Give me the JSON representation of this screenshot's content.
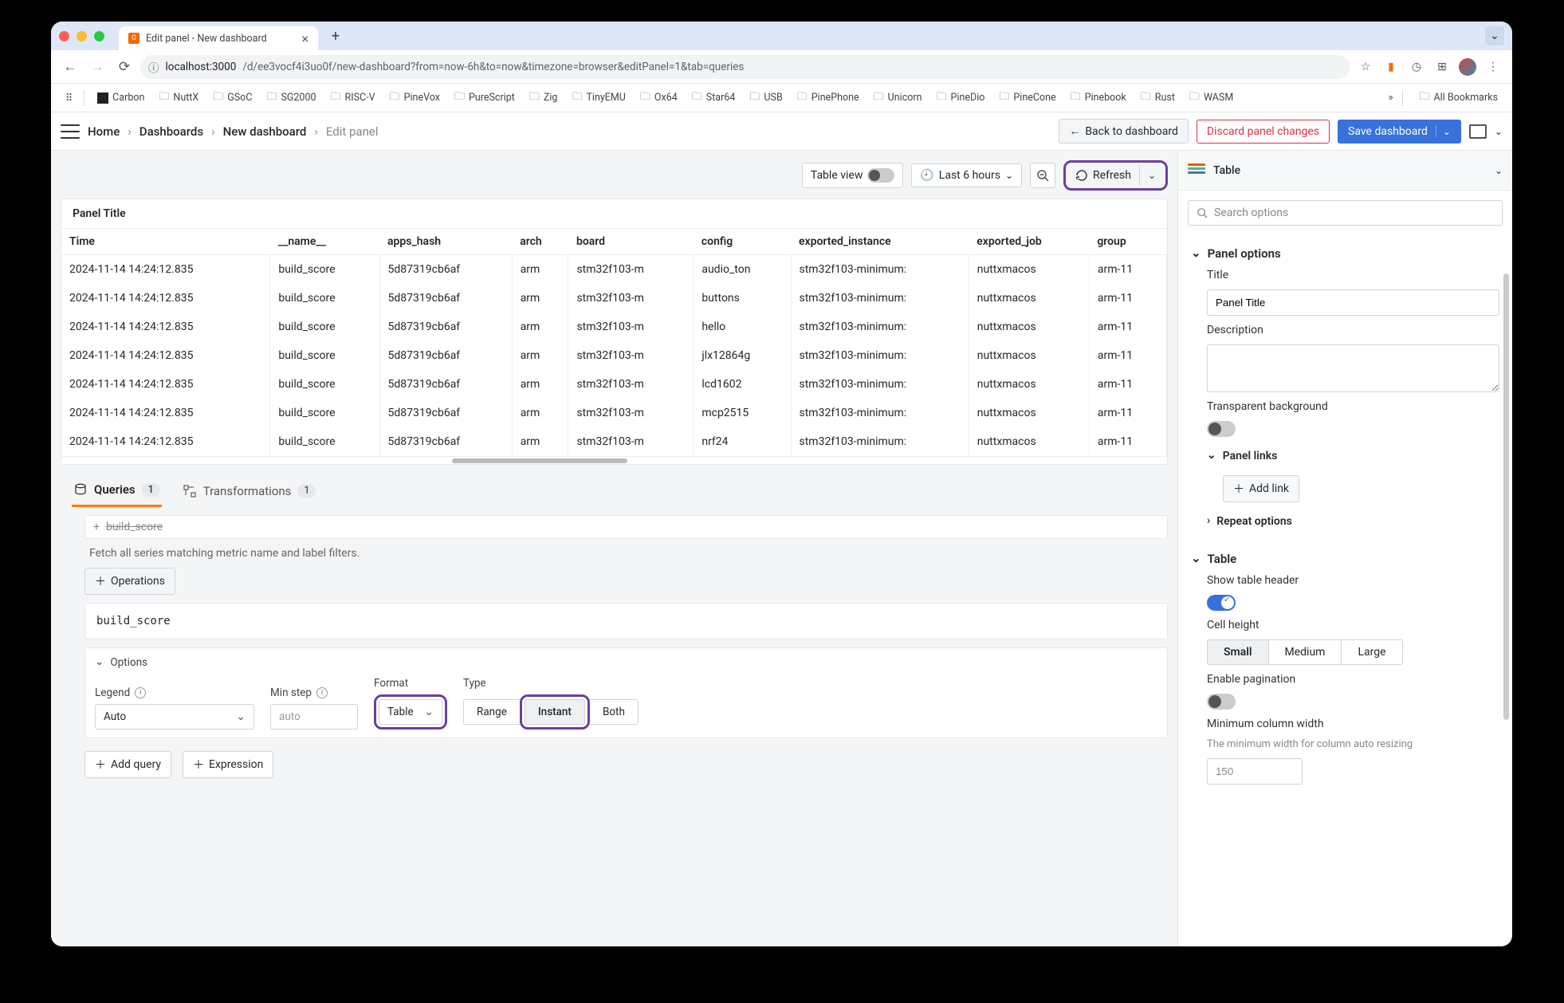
{
  "browser": {
    "tab_title": "Edit panel - New dashboard",
    "url_host": "localhost:3000",
    "url_path": "/d/ee3vocf4i3uo0f/new-dashboard?from=now-6h&to=now&timezone=browser&editPanel=1&tab=queries",
    "bookmarks": [
      "Carbon",
      "NuttX",
      "GSoC",
      "SG2000",
      "RISC-V",
      "PineVox",
      "PureScript",
      "Zig",
      "TinyEMU",
      "Ox64",
      "Star64",
      "USB",
      "PinePhone",
      "Unicorn",
      "PineDio",
      "PineCone",
      "Pinebook",
      "Rust",
      "WASM"
    ],
    "bookmarks_more": "»",
    "all_bookmarks": "All Bookmarks"
  },
  "appbar": {
    "crumbs": [
      "Home",
      "Dashboards",
      "New dashboard",
      "Edit panel"
    ],
    "back": "Back to dashboard",
    "discard": "Discard panel changes",
    "save": "Save dashboard"
  },
  "toolbar": {
    "table_view": "Table view",
    "time_range": "Last 6 hours",
    "refresh": "Refresh"
  },
  "panel": {
    "title": "Panel Title",
    "columns": [
      "Time",
      "__name__",
      "apps_hash",
      "arch",
      "board",
      "config",
      "exported_instance",
      "exported_job",
      "group"
    ],
    "rows": [
      [
        "2024-11-14 14:24:12.835",
        "build_score",
        "5d87319cb6af",
        "arm",
        "stm32f103-m",
        "audio_ton",
        "stm32f103-minimum:",
        "nuttxmacos",
        "arm-11"
      ],
      [
        "2024-11-14 14:24:12.835",
        "build_score",
        "5d87319cb6af",
        "arm",
        "stm32f103-m",
        "buttons",
        "stm32f103-minimum:",
        "nuttxmacos",
        "arm-11"
      ],
      [
        "2024-11-14 14:24:12.835",
        "build_score",
        "5d87319cb6af",
        "arm",
        "stm32f103-m",
        "hello",
        "stm32f103-minimum:",
        "nuttxmacos",
        "arm-11"
      ],
      [
        "2024-11-14 14:24:12.835",
        "build_score",
        "5d87319cb6af",
        "arm",
        "stm32f103-m",
        "jlx12864g",
        "stm32f103-minimum:",
        "nuttxmacos",
        "arm-11"
      ],
      [
        "2024-11-14 14:24:12.835",
        "build_score",
        "5d87319cb6af",
        "arm",
        "stm32f103-m",
        "lcd1602",
        "stm32f103-minimum:",
        "nuttxmacos",
        "arm-11"
      ],
      [
        "2024-11-14 14:24:12.835",
        "build_score",
        "5d87319cb6af",
        "arm",
        "stm32f103-m",
        "mcp2515",
        "stm32f103-minimum:",
        "nuttxmacos",
        "arm-11"
      ],
      [
        "2024-11-14 14:24:12.835",
        "build_score",
        "5d87319cb6af",
        "arm",
        "stm32f103-m",
        "nrf24",
        "stm32f103-minimum:",
        "nuttxmacos",
        "arm-11"
      ]
    ]
  },
  "tabs": {
    "queries": "Queries",
    "queries_count": "1",
    "transformations": "Transformations",
    "transformations_count": "1"
  },
  "query": {
    "metric_strike": "build_score",
    "hint": "Fetch all series matching metric name and label filters.",
    "operations": "Operations",
    "code": "build_score",
    "options_label": "Options",
    "legend_label": "Legend",
    "legend_value": "Auto",
    "minstep_label": "Min step",
    "minstep_placeholder": "auto",
    "format_label": "Format",
    "format_value": "Table",
    "type_label": "Type",
    "type_options": [
      "Range",
      "Instant",
      "Both"
    ],
    "add_query": "Add query",
    "expression": "Expression"
  },
  "right": {
    "vis": "Table",
    "search_placeholder": "Search options",
    "panel_options": "Panel options",
    "title_label": "Title",
    "title_value": "Panel Title",
    "desc_label": "Description",
    "transparent": "Transparent background",
    "panel_links": "Panel links",
    "add_link": "Add link",
    "repeat": "Repeat options",
    "table_section": "Table",
    "show_header": "Show table header",
    "cell_height": "Cell height",
    "sizes": [
      "Small",
      "Medium",
      "Large"
    ],
    "pagination": "Enable pagination",
    "min_col": "Minimum column width",
    "min_col_desc": "The minimum width for column auto resizing",
    "min_col_value": "150"
  }
}
